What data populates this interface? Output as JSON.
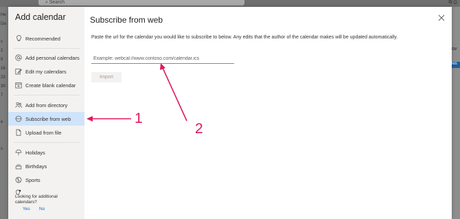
{
  "background": {
    "search_label": "Search",
    "left_labels": [
      "He",
      "Da",
      "",
      "s",
      "2",
      "9",
      "16",
      "23",
      "30",
      "7",
      "",
      "",
      "e",
      "",
      "",
      "s"
    ],
    "right_label": "ov",
    "right_badge": "les"
  },
  "sidebar": {
    "title": "Add calendar",
    "items": [
      {
        "label": "Recommended",
        "icon": "lightbulb-icon"
      },
      {
        "label": "Add personal calendars",
        "icon": "at-sign-icon"
      },
      {
        "label": "Edit my calendars",
        "icon": "edit-icon"
      },
      {
        "label": "Create blank calendar",
        "icon": "calendar-add-icon"
      },
      {
        "label": "Add from directory",
        "icon": "people-icon"
      },
      {
        "label": "Subscribe from web",
        "icon": "globe-icon"
      },
      {
        "label": "Upload from file",
        "icon": "document-icon"
      },
      {
        "label": "Holidays",
        "icon": "holiday-icon"
      },
      {
        "label": "Birthdays",
        "icon": "birthday-icon"
      },
      {
        "label": "Sports",
        "icon": "sports-icon"
      }
    ],
    "prompt": "Looking for additional calendars?",
    "yes_label": "Yes",
    "no_label": "No"
  },
  "main": {
    "title": "Subscribe from web",
    "instructions": "Paste the url for the calendar you would like to subscribe to below. Any edits that the author of the calendar makes will be updated automatically.",
    "url_value": "",
    "url_placeholder": "Example: webcal://www.contoso.com/calendar.ics",
    "import_label": "Import"
  },
  "annotations": {
    "label_1": "1",
    "label_2": "2",
    "color": "#e0195a"
  }
}
